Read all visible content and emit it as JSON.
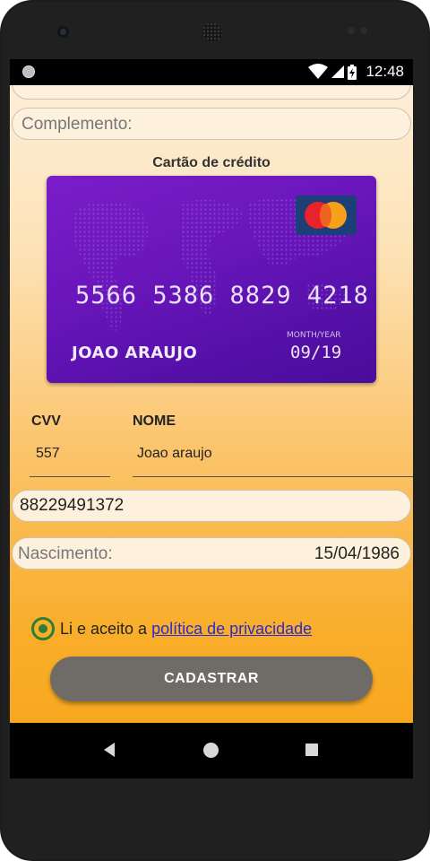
{
  "status_bar": {
    "time": "12:48"
  },
  "form": {
    "complemento_placeholder": "Complemento:",
    "card_section_title": "Cartão de crédito",
    "cvv_label": "CVV",
    "cvv_value": "557",
    "nome_label": "NOME",
    "nome_value": "Joao araujo",
    "phone_value": "88229491372",
    "nascimento_placeholder": "Nascimento:",
    "nascimento_value": "15/04/1986",
    "terms_prefix": "Li e aceito a ",
    "terms_link": "política de privacidade",
    "submit_label": "CADASTRAR"
  },
  "card": {
    "number": "5566  5386  8829  4218",
    "holder": "JOAO  ARAUJO",
    "expiry_label": "MONTH/YEAR",
    "expiry": "09/19",
    "brand": "mastercard-logo",
    "color_primary": "#6a16bc"
  },
  "colors": {
    "accent_green": "#2e7d32",
    "button_gray": "#6f6b66",
    "link_blue": "#2a2ad6",
    "background_orange": "#f8a81f"
  }
}
